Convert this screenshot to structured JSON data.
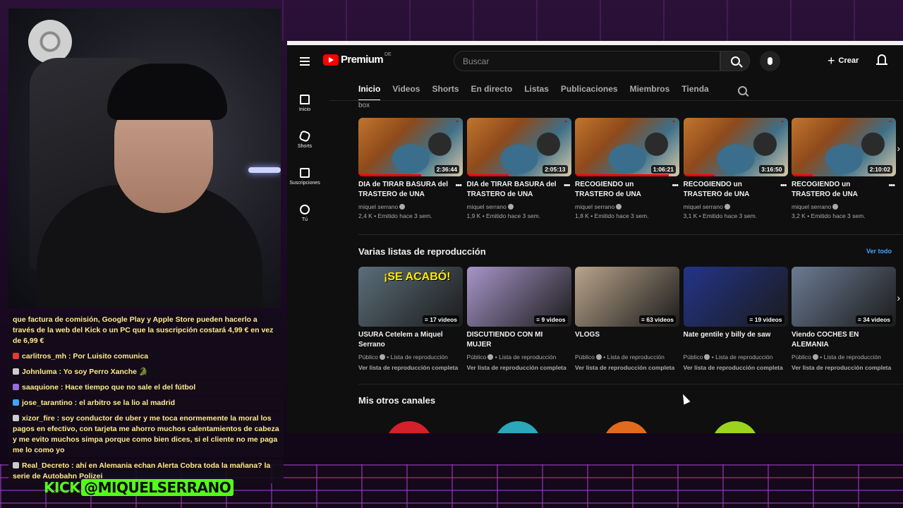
{
  "youtube": {
    "logo_text": "Premium",
    "logo_region": "DE",
    "search_placeholder": "Buscar",
    "create_label": "Crear",
    "rail": [
      {
        "label": "Inicio",
        "icon": "home-icon"
      },
      {
        "label": "Shorts",
        "icon": "shorts-icon"
      },
      {
        "label": "Suscripciones",
        "icon": "subscriptions-icon"
      },
      {
        "label": "Tú",
        "icon": "you-icon"
      }
    ],
    "tabs": [
      "Inicio",
      "Videos",
      "Shorts",
      "En directo",
      "Listas",
      "Publicaciones",
      "Miembros",
      "Tienda"
    ],
    "active_tab": "Inicio",
    "cut_text": "box",
    "videos": [
      {
        "title": "DIA de TIRAR BASURA del TRASTERO de UNA SUBAS…",
        "channel": "miquel serrano",
        "stats": "2,4 K • Emitido hace 3 sem.",
        "duration": "2:36:44",
        "progress": 0.6
      },
      {
        "title": "DIA de TIRAR BASURA del TRASTERO de UNA SUBAS…",
        "channel": "miquel serrano",
        "stats": "1,9 K • Emitido hace 3 sem.",
        "duration": "2:05:13",
        "progress": 0.4
      },
      {
        "title": "RECOGIENDO un TRASTERO de UNA SUBASTA que GAN…",
        "channel": "miquel serrano",
        "stats": "1,8 K • Emitido hace 3 sem.",
        "duration": "1:06:21",
        "progress": 0.9
      },
      {
        "title": "RECOGIENDO un TRASTERO de UNA SUBASTA que GAN…",
        "channel": "miquel serrano",
        "stats": "3,1 K • Emitido hace 3 sem.",
        "duration": "3:16:50",
        "progress": 0.3
      },
      {
        "title": "RECOGIENDO un TRASTERO de UNA SUBASTA que GAN…",
        "channel": "miquel serrano",
        "stats": "3,2 K • Emitido hace 3 sem.",
        "duration": "2:10:02",
        "progress": 0.2
      }
    ],
    "playlists_section": {
      "title": "Varias listas de reproducción",
      "see_all": "Ver todo",
      "items": [
        {
          "title": "USURA Cetelem a Miquel Serrano",
          "visibility": "Público",
          "type": "Lista de reproducción",
          "link": "Ver lista de reproducción completa",
          "count": "17 videos",
          "caption": "¡SE ACABÓ!",
          "color": "#5b6e7a"
        },
        {
          "title": "DISCUTIENDO CON MI MUJER",
          "visibility": "Público",
          "type": "Lista de reproducción",
          "link": "Ver lista de reproducción completa",
          "count": "9 videos",
          "caption": "",
          "color": "#a795c9"
        },
        {
          "title": "VLOGS",
          "visibility": "Público",
          "type": "Lista de reproducción",
          "link": "Ver lista de reproducción completa",
          "count": "63 videos",
          "caption": "",
          "color": "#b9a48b"
        },
        {
          "title": "Nate gentile y billy de saw",
          "visibility": "Público",
          "type": "Lista de reproducción",
          "link": "Ver lista de reproducción completa",
          "count": "19 videos",
          "caption": "",
          "color": "#23348a"
        },
        {
          "title": "Viendo COCHES EN ALEMANIA",
          "visibility": "Público",
          "type": "Lista de reproducción",
          "link": "Ver lista de reproducción completa",
          "count": "34 videos",
          "caption": "",
          "color": "#6b7b94"
        }
      ]
    },
    "channels_section": {
      "title": "Mis otros canales",
      "avatar_colors": [
        "#d3202a",
        "#2aa7b9",
        "#e26a1c",
        "#9bd31e"
      ]
    }
  },
  "chat": {
    "messages": [
      {
        "user": "",
        "text": "que factura de comisión, Google Play y Apple Store pueden hacerlo a través de la web del Kick o un PC que la suscripción costará 4,99 € en vez de 6,99 €",
        "badge_color": ""
      },
      {
        "user": "carlitros_mh",
        "text": "Por Luisito comunica",
        "badge_color": "#e53935"
      },
      {
        "user": "Johnluma",
        "text": "Yo soy Perro Xanche 🐊",
        "badge_color": "#cccccc"
      },
      {
        "user": "saaquione",
        "text": "Hace tiempo que no sale el del fútbol",
        "badge_color": "#9c6ade"
      },
      {
        "user": "jose_tarantino",
        "text": "el arbitro se la lio al madrid",
        "badge_color": "#3ea6ff"
      },
      {
        "user": "xizor_fire",
        "text": "soy conductor de uber y me toca enormemente la moral los pagos en efectivo, con tarjeta me ahorro muchos calentamientos de cabeza y me evito muchos simpa porque como bien dices, si el cliente no me paga me lo como yo",
        "badge_color": "#cccccc"
      },
      {
        "user": "Real_Decreto",
        "text": "ahí en Alemania echan Alerta Cobra toda la mañana? la serie de Autobahn Polizei",
        "badge_color": "#cccccc"
      }
    ]
  },
  "brand": {
    "kick_text": "KICK",
    "handle": "@MIQUELSERRANO",
    "kick_color": "#53fc18"
  }
}
